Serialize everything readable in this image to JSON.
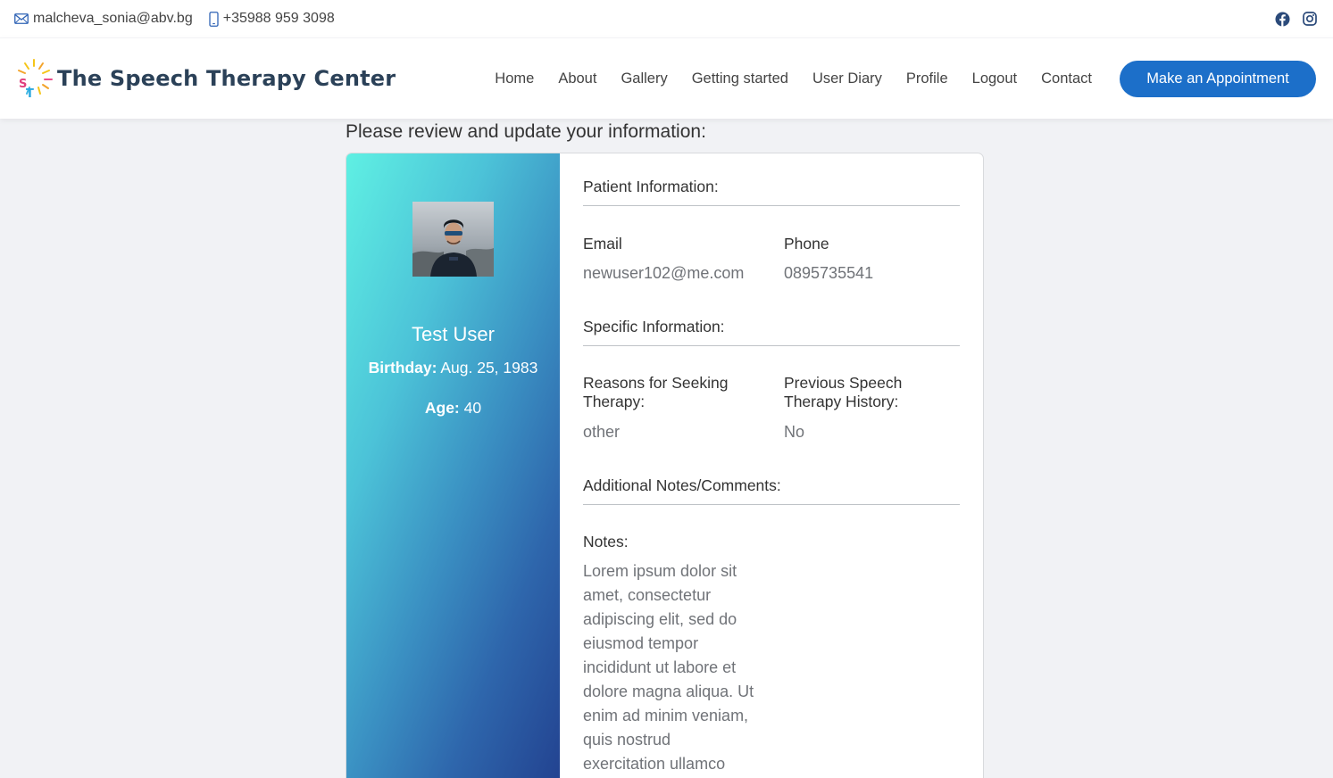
{
  "topbar": {
    "email": "malcheva_sonia@abv.bg",
    "phone": "+35988 959 3098",
    "icons": [
      "envelope-icon",
      "mobile-phone-icon",
      "facebook-icon",
      "instagram-icon"
    ]
  },
  "header": {
    "brand_name": "The Speech Therapy Center",
    "logo_letters": {
      "s": "S",
      "t": "T"
    },
    "nav": [
      "Home",
      "About",
      "Gallery",
      "Getting started",
      "User Diary",
      "Profile",
      "Logout",
      "Contact"
    ],
    "cta_label": "Make an Appointment"
  },
  "main": {
    "heading": "Please review and update your information:",
    "profile": {
      "name": "Test User",
      "birthday_label": "Birthday:",
      "birthday": "Aug. 25, 1983",
      "age_label": "Age:",
      "age": "40"
    },
    "patient_info": {
      "title": "Patient Information:",
      "email_label": "Email",
      "email": "newuser102@me.com",
      "phone_label": "Phone",
      "phone": "0895735541"
    },
    "specific_info": {
      "title": "Specific Information:",
      "reasons_label": "Reasons for Seeking Therapy:",
      "reasons": "other",
      "history_label": "Previous Speech Therapy History:",
      "history": "No"
    },
    "additional": {
      "title": "Additional Notes/Comments:",
      "notes_label": "Notes:",
      "notes": "Lorem ipsum dolor sit amet, consectetur adipiscing elit, sed do eiusmod tempor incididunt ut labore et dolore magna aliqua. Ut enim ad minim veniam, quis nostrud exercitation ullamco"
    }
  },
  "colors": {
    "accent": "#1c6fc9",
    "brand_text": "#2b4158",
    "gradient_start": "#5ff0e3",
    "gradient_end": "#22418f"
  }
}
